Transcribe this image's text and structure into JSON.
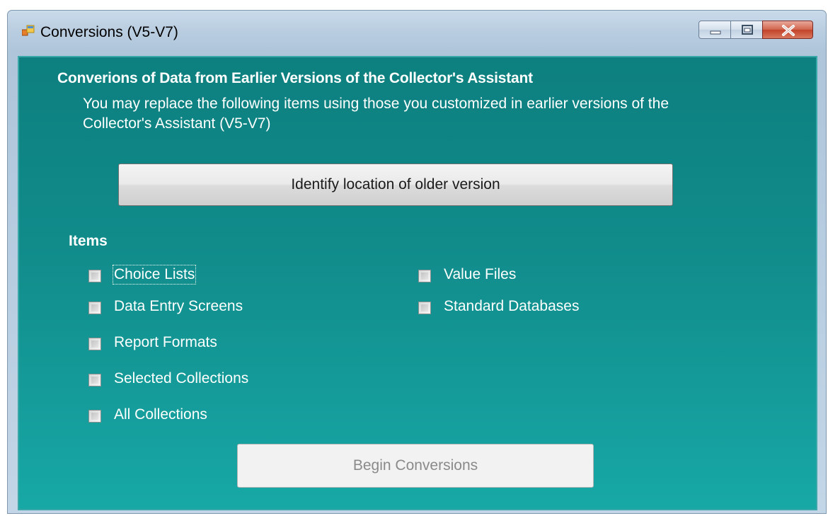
{
  "window": {
    "title": "Conversions (V5-V7)",
    "controls": {
      "minimize": "minimize",
      "maximize": "maximize",
      "close": "close"
    }
  },
  "content": {
    "heading": "Converions of Data from Earlier Versions of the Collector's Assistant",
    "description": "You may replace the following items using those you customized in earlier versions of the Collector's Assistant (V5-V7)",
    "identify_button": "Identify location of older version",
    "items_label": "Items",
    "left_items": [
      {
        "label": "Choice Lists",
        "checked": false,
        "focused": true
      },
      {
        "label": "Data Entry Screens",
        "checked": false
      },
      {
        "label": "Report Formats",
        "checked": false
      },
      {
        "label": "Selected Collections",
        "checked": false
      },
      {
        "label": "All Collections",
        "checked": false
      }
    ],
    "right_items": [
      {
        "label": "Value Files",
        "checked": false
      },
      {
        "label": "Standard Databases",
        "checked": false
      }
    ],
    "begin_button": "Begin Conversions",
    "begin_button_enabled": false
  },
  "colors": {
    "client_top": "#0d7f7f",
    "client_bottom": "#17a8a6",
    "text": "#ffffff",
    "close_button": "#c2432b"
  },
  "icons": {
    "app": "app-window-icon",
    "minimize": "minimize-icon",
    "maximize": "maximize-icon",
    "close": "close-icon"
  }
}
